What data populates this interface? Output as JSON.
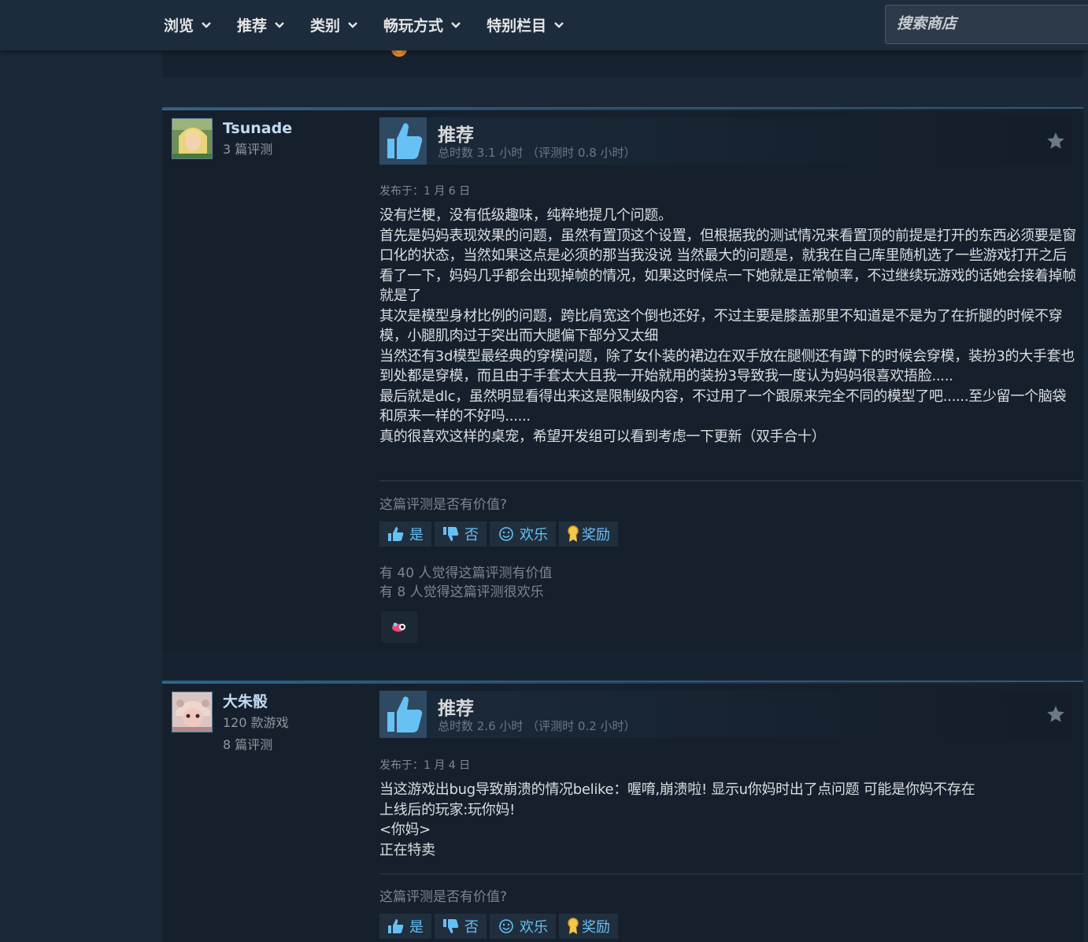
{
  "nav": {
    "items": [
      {
        "label": "浏览"
      },
      {
        "label": "推荐"
      },
      {
        "label": "类别"
      },
      {
        "label": "畅玩方式"
      },
      {
        "label": "特别栏目"
      }
    ],
    "search_placeholder": "搜索商店"
  },
  "reviews": [
    {
      "author": "Tsunade",
      "stats": [
        "3 篇评测"
      ],
      "verdict": "推荐",
      "hours": "总时数 3.1 小时 （评测时 0.8 小时）",
      "posted": "发布于：1 月 6 日",
      "body": "没有烂梗，没有低级趣味，纯粹地提几个问题。\n首先是妈妈表现效果的问题，虽然有置顶这个设置，但根据我的测试情况来看置顶的前提是打开的东西必须要是窗口化的状态，当然如果这点是必须的那当我没说 当然最大的问题是，就我在自己库里随机选了一些游戏打开之后看了一下，妈妈几乎都会出现掉帧的情况，如果这时候点一下她就是正常帧率，不过继续玩游戏的话她会接着掉帧就是了\n其次是模型身材比例的问题，跨比肩宽这个倒也还好，不过主要是膝盖那里不知道是不是为了在折腿的时候不穿模，小腿肌肉过于突出而大腿偏下部分又太细\n当然还有3d模型最经典的穿模问题，除了女仆装的裙边在双手放在腿侧还有蹲下的时候会穿模，装扮3的大手套也到处都是穿模，而且由于手套太大且我一开始就用的装扮3导致我一度认为妈妈很喜欢捂脸.....\n最后就是dlc，虽然明显看得出来这是限制级内容，不过用了一个跟原来完全不同的模型了吧......至少留一个脑袋和原来一样的不好吗......\n真的很喜欢这样的桌宠，希望开发组可以看到考虑一下更新（双手合十）",
      "question": "这篇评测是否有价值?",
      "buttons": {
        "yes": "是",
        "no": "否",
        "funny": "欢乐",
        "award": "奖励"
      },
      "helpful": [
        "有 40 人觉得这篇评测有价值",
        "有 8 人觉得这篇评测很欢乐"
      ]
    },
    {
      "author": "大朱骰",
      "stats": [
        "120 款游戏",
        "8 篇评测"
      ],
      "verdict": "推荐",
      "hours": "总时数 2.6 小时 （评测时 0.2 小时）",
      "posted": "发布于：1 月 4 日",
      "body": "当这游戏出bug导致崩溃的情况belike：喔唷,崩溃啦! 显示u你妈时出了点问题 可能是你妈不存在\n上线后的玩家:玩你妈!\n<你妈>\n正在特卖",
      "question": "这篇评测是否有价值?",
      "buttons": {
        "yes": "是",
        "no": "否",
        "funny": "欢乐",
        "award": "奖励"
      }
    }
  ],
  "colors": {
    "background": "#1b2838",
    "link_blue": "#66c0f4",
    "author_name": "#c1dbf4",
    "thumb_up": "#67c1f5"
  }
}
